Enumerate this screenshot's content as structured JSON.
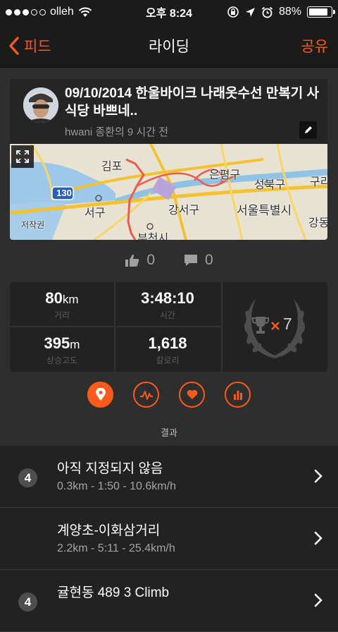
{
  "status": {
    "carrier": "olleh",
    "time": "오후 8:24",
    "battery": "88%",
    "battery_level": 0.88
  },
  "nav": {
    "back_label": "피드",
    "title": "라이딩",
    "share_label": "공유"
  },
  "activity": {
    "title": "09/10/2014 한울바이크 나래옷수선 만복기 사식당 바쁘네..",
    "meta": "hwani 종환의 9 시간 전",
    "map_labels": {
      "gimpo": "김포",
      "route130": "130",
      "seogu": "서구",
      "jejakgwon": "저작권",
      "gangseogu": "강서구",
      "eunpyeonggu": "은평구",
      "seongbukgu": "성북구",
      "seoul": "서울특별시",
      "bucheon": "부천시",
      "gang": "강동",
      "gu": "구리"
    }
  },
  "social": {
    "kudos": "0",
    "comments": "0"
  },
  "stats": {
    "distance": {
      "value": "80",
      "unit": "km",
      "label": "거리"
    },
    "time": {
      "value": "3:48:10",
      "label": "시간"
    },
    "elevation": {
      "value": "395",
      "unit": "m",
      "label": "상승고도"
    },
    "calories": {
      "value": "1,618",
      "label": "칼로리"
    },
    "achievements": "7"
  },
  "tabs": [
    {
      "name": "map-tab",
      "icon": "location-pin-icon",
      "active": true
    },
    {
      "name": "analysis-tab",
      "icon": "pulse-icon",
      "active": false
    },
    {
      "name": "heart-tab",
      "icon": "heart-icon",
      "active": false
    },
    {
      "name": "chart-tab",
      "icon": "bar-chart-icon",
      "active": false
    }
  ],
  "results_title": "결과",
  "segments": [
    {
      "rank": "4",
      "name": "아직 지정되지 않음",
      "detail": "0.3km - 1:50 - 10.6km/h"
    },
    {
      "rank": "",
      "name": "계양초-이화삼거리",
      "detail": "2.2km - 5:11 - 25.4km/h"
    },
    {
      "rank": "4",
      "name": "귤현동 489 3 Climb",
      "detail": ""
    }
  ],
  "colors": {
    "accent": "#fc5a1a",
    "background": "#2e2e2e",
    "card": "#222222"
  }
}
